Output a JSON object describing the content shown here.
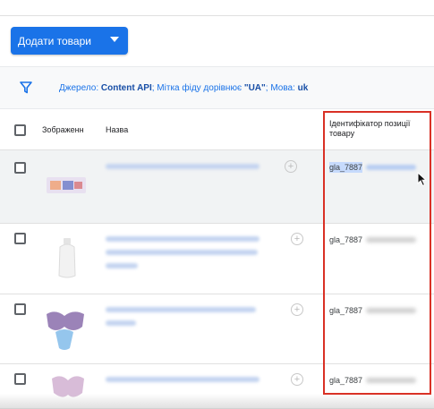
{
  "toolbar": {
    "add_products_label": "Додати товари"
  },
  "filter": {
    "source_label": "Джерело: ",
    "source_value": "Content API",
    "feed_label": "; Мітка фіду дорівнює ",
    "feed_value": "\"UA\"",
    "language_label": "; Мова: ",
    "language_value": "uk"
  },
  "table": {
    "headers": {
      "image": "Зображенн",
      "name": "Назва",
      "item_id": "Ідентифікатор позиції товару"
    },
    "rows": [
      {
        "item_id": "gla_7887"
      },
      {
        "item_id": "gla_7887"
      },
      {
        "item_id": "gla_7887"
      },
      {
        "item_id": "gla_7887"
      }
    ]
  },
  "colors": {
    "accent": "#1a73e8",
    "highlight_border": "#d93025",
    "selected_row": "#f1f3f4"
  },
  "icons": {
    "filter": "filter-icon",
    "dropdown": "chevron-down-icon",
    "add": "add-circle-icon",
    "cursor": "mouse-pointer-icon"
  }
}
